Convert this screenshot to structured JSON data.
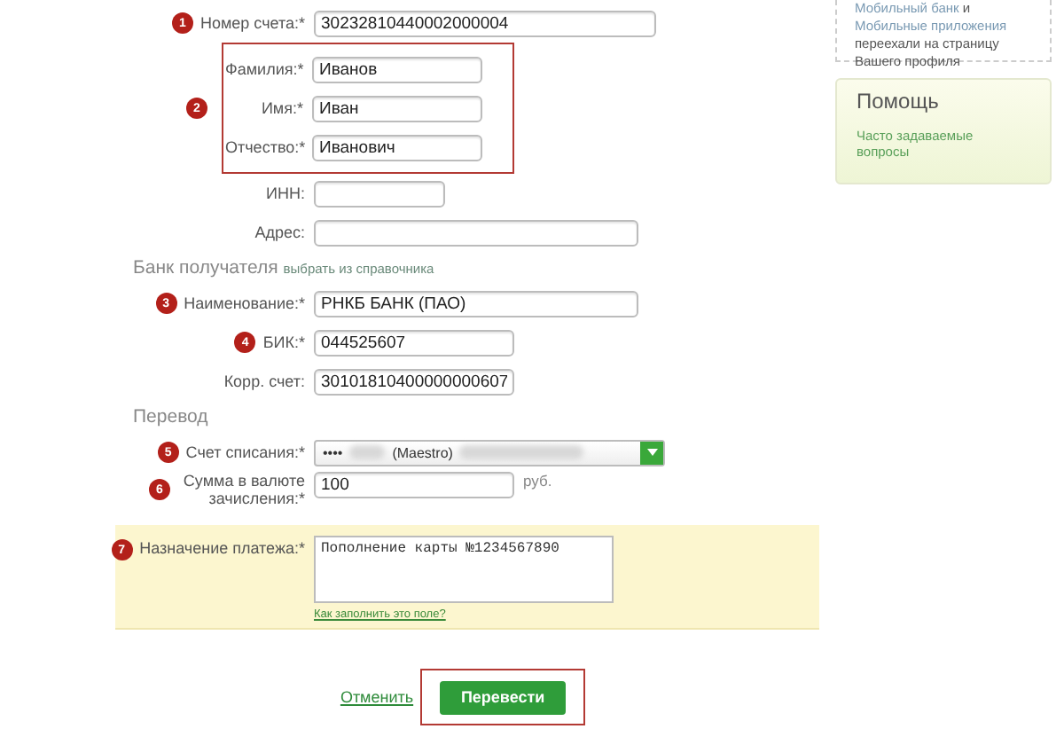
{
  "recipient": {
    "account": {
      "badge": "1",
      "label": "Номер счета:*",
      "value": "30232810440002000004"
    },
    "full_name": {
      "badge": "2",
      "highlighted": true,
      "fields": [
        {
          "label": "Фамилия:*",
          "value": "Иванов"
        },
        {
          "label": "Имя:*",
          "value": "Иван"
        },
        {
          "label": "Отчество:*",
          "value": "Иванович"
        }
      ]
    },
    "inn": {
      "label": "ИНН:"
    },
    "address": {
      "label": "Адрес:"
    }
  },
  "bank": {
    "heading": "Банк получателя",
    "link": "выбрать из справочника",
    "name": {
      "badge": "3",
      "label": "Наименование:*",
      "value": "РНКБ БАНК (ПАО)"
    },
    "bik": {
      "badge": "4",
      "label": "БИК:*",
      "value": "044525607"
    },
    "corr_account": {
      "label": "Корр. счет:",
      "value": "30101810400000000607"
    }
  },
  "transfer": {
    "heading": "Перевод",
    "debit_account": {
      "badge": "5",
      "label": "Счет списания:*",
      "mask": "••••",
      "card_type": "(Maestro)"
    },
    "amount": {
      "badge": "6",
      "label": "Сумма в валюте зачисления:*",
      "value": "100",
      "unit": "руб."
    },
    "purpose": {
      "badge": "7",
      "label": "Назначение платежа:*",
      "value": "Пополнение карты №1234567890",
      "help_link": "Как заполнить это поле?"
    }
  },
  "actions": {
    "cancel": "Отменить",
    "submit": "Перевести",
    "submit_highlighted": true
  },
  "sidebar": {
    "notice": [
      {
        "text": "Мобильный банк",
        "link": true
      },
      {
        "text": "и",
        "link": false
      },
      {
        "text": "Мобильные приложения",
        "link": true
      },
      {
        "text": "переехали на страницу Вашего профиля",
        "link": false
      }
    ],
    "help": {
      "title": "Помощь",
      "links": [
        "Часто задаваемые вопросы"
      ]
    }
  }
}
